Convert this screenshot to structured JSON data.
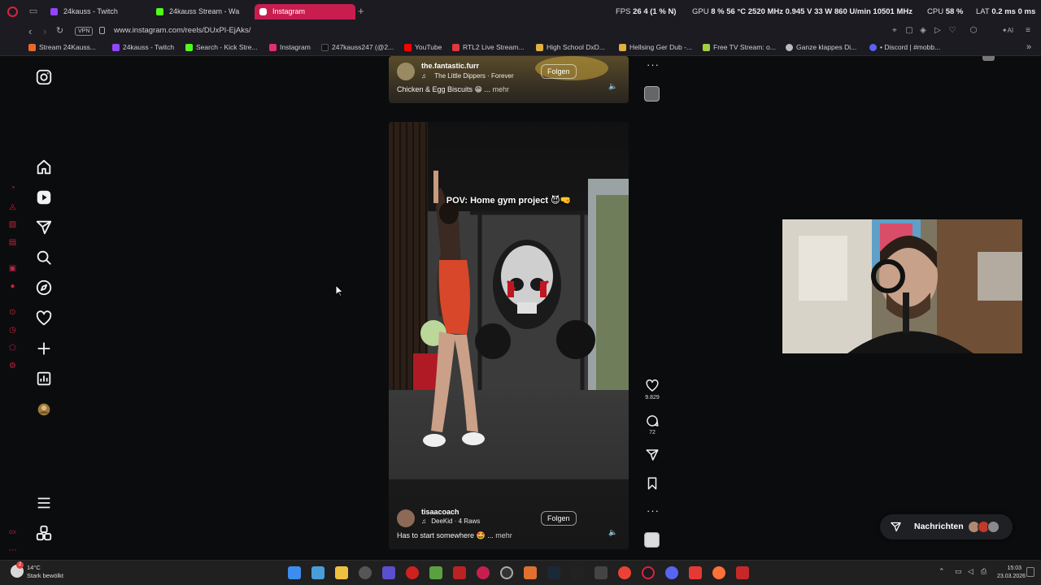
{
  "browser": {
    "tabs": [
      {
        "label": "24kauss - Twitch",
        "active": false
      },
      {
        "label": "24kauss Stream - Wa",
        "active": false
      },
      {
        "label": "Instagram",
        "active": true
      }
    ],
    "hud": {
      "fps_label": "FPS",
      "fps_value": "26",
      "fps_extra": "4 (1 % N)",
      "gpu_label": "GPU",
      "gpu_value": "8 %  56 °C  2520 MHz  0.945 V  33 W  860 U/min  10501 MHz",
      "cpu_label": "CPU",
      "cpu_value": "58 %",
      "lat_label": "LAT",
      "lat_value": "0.2 ms 0 ms"
    },
    "address": {
      "vpn": "VPN",
      "url": "www.instagram.com/reels/DUxPI-EjAks/"
    },
    "bookmarks": [
      "Stream 24Kauss...",
      "24kauss - Twitch",
      "Search - Kick Stre...",
      "Instagram",
      "247kauss247 (@2...",
      "YouTube",
      "RTL2 Live Stream...",
      "High School DxD...",
      "Hellsing Ger Dub -...",
      "Free TV Stream: o...",
      "Ganze klappes Di...",
      "• Discord | #mobb..."
    ]
  },
  "instagram": {
    "nav_icons": [
      "instagram-logo-icon",
      "home-icon",
      "reels-icon",
      "send-icon",
      "search-icon",
      "explore-icon",
      "heart-icon",
      "create-icon",
      "dashboard-icon",
      "profile-avatar",
      "menu-icon",
      "meta-apps-icon"
    ],
    "reel_top": {
      "username": "the.fantastic.furr",
      "audio": "The Little Dippers · Forever",
      "follow": "Folgen",
      "caption": "Chicken & Egg Biscuits 😁 ...",
      "more": "mehr"
    },
    "reel_main": {
      "overlay_title": "POV: Home gym project 😈🤜",
      "username": "tisaacoach",
      "audio": "DeeKid · 4 Raws",
      "follow": "Folgen",
      "caption": "Has to start somewhere 🤩 ...",
      "more": "mehr"
    },
    "actions": {
      "likes": "9.829",
      "comments": "72"
    },
    "messages": {
      "label": "Nachrichten"
    }
  },
  "taskbar": {
    "weather_temp": "14°C",
    "weather_desc": "Stark bewölkt",
    "time": "15:03",
    "date": "23.03.2026"
  },
  "colors": {
    "opera_red": "#d8243e",
    "active_tab": "#c81e4f",
    "page_bg": "#0b0c0d"
  }
}
